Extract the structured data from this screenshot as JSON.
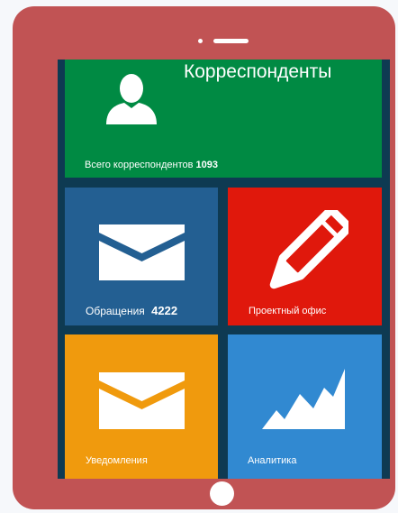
{
  "colors": {
    "tablet_frame": "#c15354",
    "screen_bg": "#0e3a52",
    "correspondents_tile": "#008a43",
    "appeals_tile": "#235f92",
    "project_office_tile": "#e0180c",
    "notifications_tile": "#f09a0d",
    "analytics_tile": "#3189d1"
  },
  "tiles": {
    "correspondents": {
      "title": "Корреспонденты",
      "caption": "Всего корреспондентов",
      "count": "1093",
      "icon": "user-icon"
    },
    "appeals": {
      "caption": "Обращения",
      "count": "4222",
      "icon": "envelope-icon"
    },
    "project_office": {
      "caption": "Проектный офис",
      "icon": "pencil-icon"
    },
    "notifications": {
      "caption": "Уведомления",
      "icon": "envelope-icon"
    },
    "analytics": {
      "caption": "Аналитика",
      "icon": "chart-icon"
    }
  }
}
